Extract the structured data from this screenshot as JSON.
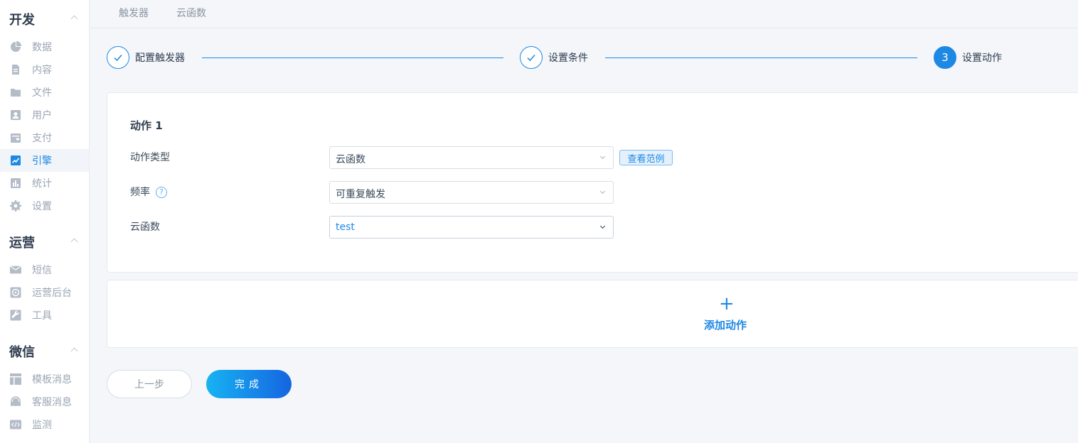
{
  "sidebar": {
    "sections": [
      {
        "title": "开发",
        "items": [
          {
            "label": "数据",
            "icon": "pie-chart-icon"
          },
          {
            "label": "内容",
            "icon": "document-icon"
          },
          {
            "label": "文件",
            "icon": "folder-icon"
          },
          {
            "label": "用户",
            "icon": "user-card-icon"
          },
          {
            "label": "支付",
            "icon": "wallet-icon"
          },
          {
            "label": "引擎",
            "icon": "trend-chart-icon",
            "active": true
          },
          {
            "label": "统计",
            "icon": "bar-chart-icon"
          },
          {
            "label": "设置",
            "icon": "gear-icon"
          }
        ]
      },
      {
        "title": "运营",
        "items": [
          {
            "label": "短信",
            "icon": "envelope-icon"
          },
          {
            "label": "运营后台",
            "icon": "dashboard-icon"
          },
          {
            "label": "工具",
            "icon": "wrench-icon"
          }
        ]
      },
      {
        "title": "微信",
        "items": [
          {
            "label": "模板消息",
            "icon": "layout-icon"
          },
          {
            "label": "客服消息",
            "icon": "headset-icon"
          },
          {
            "label": "监测",
            "icon": "code-icon"
          }
        ]
      }
    ]
  },
  "top_tabs": [
    "触发器",
    "云函数"
  ],
  "steps": [
    {
      "label": "配置触发器",
      "status": "done"
    },
    {
      "label": "设置条件",
      "status": "done"
    },
    {
      "label": "设置动作",
      "status": "current",
      "number": "3"
    }
  ],
  "action": {
    "title": "动作 1",
    "type_label": "动作类型",
    "type_value": "云函数",
    "example_button": "查看范例",
    "frequency_label": "频率",
    "frequency_help": "?",
    "frequency_value": "可重复触发",
    "function_label": "云函数",
    "function_value": "test"
  },
  "add_action": {
    "plus": "+",
    "label": "添加动作"
  },
  "buttons": {
    "prev": "上一步",
    "done": "完成"
  },
  "colors": {
    "accent": "#1e88e5",
    "sidebar_text": "#9aa5b3",
    "background": "#f4f6fa"
  }
}
